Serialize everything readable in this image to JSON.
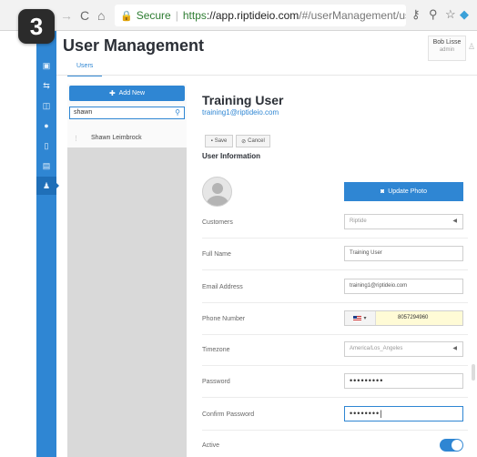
{
  "step_badge": "3",
  "browser": {
    "secure_label": "Secure",
    "url_proto": "https",
    "url_host": "://app.riptideio.com",
    "url_path": "/#/userManagement/users?ite..."
  },
  "header": {
    "title": "User Management",
    "user_name": "Bob Lisse",
    "user_role": "admin"
  },
  "tabs": [
    {
      "label": "Users"
    }
  ],
  "list": {
    "add_label": "Add New",
    "search_value": "shawn",
    "items": [
      {
        "label": "Shawn Leimbrock"
      }
    ]
  },
  "detail": {
    "name": "Training User",
    "email": "training1@riptideio.com",
    "save_label": "Save",
    "cancel_label": "Cancel",
    "section_title": "User Information",
    "update_photo_label": "Update Photo",
    "fields": {
      "customers": {
        "label": "Customers",
        "value": "Riptide"
      },
      "full_name": {
        "label": "Full Name",
        "value": "Training User"
      },
      "email": {
        "label": "Email Address",
        "value": "training1@riptideio.com"
      },
      "phone": {
        "label": "Phone Number",
        "value": "8057294960"
      },
      "timezone": {
        "label": "Timezone",
        "value": "America/Los_Angeles"
      },
      "password": {
        "label": "Password",
        "value": "•••••••••"
      },
      "confirm_password": {
        "label": "Confirm Password",
        "value": "••••••••|"
      },
      "active": {
        "label": "Active",
        "value": true
      }
    }
  },
  "colors": {
    "accent": "#2f86d3",
    "secure": "#2e7d32",
    "phone_highlight": "#fffbd6"
  }
}
